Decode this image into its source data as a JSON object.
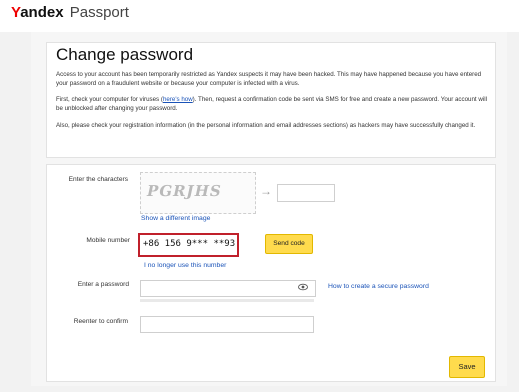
{
  "header": {
    "brand_y": "Y",
    "brand_rest": "andex",
    "product": "Passport"
  },
  "intro": {
    "title": "Change password",
    "paragraph1": "Access to your account has been temporarily restricted as Yandex suspects it may have been hacked. This may have happened because you have entered your password on a fraudulent website or because your computer is infected with a virus.",
    "paragraph2_before": "First, check your computer for viruses (",
    "paragraph2_link": "here's how",
    "paragraph2_after": "). Then, request a confirmation code be sent via SMS for free and create a new password. Your account will be unblocked after changing your password.",
    "paragraph3": "Also, please check your registration information (in the personal information and email addresses sections) as hackers may have successfully changed it."
  },
  "form": {
    "captcha_label": "Enter the characters",
    "captcha_image_text": "PGRJHS",
    "captcha_arrow": "→",
    "show_different_image": "Show a different image",
    "mobile_label": "Mobile number",
    "mobile_value": "+86 156 9*** **93",
    "send_code": "Send code",
    "no_longer_use": "I no longer use this number",
    "password_label": "Enter a password",
    "password_help_link": "How to create a secure password",
    "confirm_label": "Reenter to confirm",
    "save": "Save"
  },
  "icons": {
    "arrow": "arrow-right-icon",
    "eye": "eye-icon"
  },
  "colors": {
    "accent_yellow": "#ffdb4d",
    "highlight_red": "#c0202b",
    "link_blue": "#1a53b8",
    "brand_red": "#e00000"
  }
}
